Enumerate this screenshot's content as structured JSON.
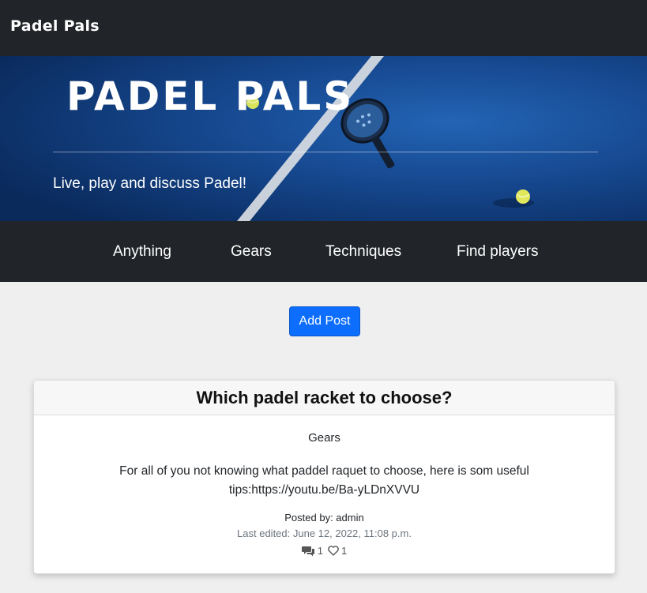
{
  "navbar": {
    "brand": "Padel Pals"
  },
  "hero": {
    "title": "PADEL PALS",
    "tagline": "Live, play and discuss Padel!"
  },
  "categories": [
    {
      "label": "Anything"
    },
    {
      "label": "Gears"
    },
    {
      "label": "Techniques"
    },
    {
      "label": "Find players"
    }
  ],
  "actions": {
    "add_post_label": "Add Post"
  },
  "post": {
    "title": "Which padel racket to choose?",
    "category": "Gears",
    "content": "For all of you not knowing what paddel raquet to choose, here is som useful tips:https://youtu.be/Ba-yLDnXVVU",
    "posted_by": "Posted by: admin",
    "last_edited": "Last edited: June 12, 2022, 11:08 p.m.",
    "comments_count": "1",
    "likes_count": "1",
    "comments_icon": "comments-icon",
    "likes_icon": "heart-outline-icon"
  },
  "colors": {
    "dark_bg": "#212529",
    "primary": "#0d6efd",
    "page_bg": "#efefef",
    "hero_blue": "#15468c"
  }
}
